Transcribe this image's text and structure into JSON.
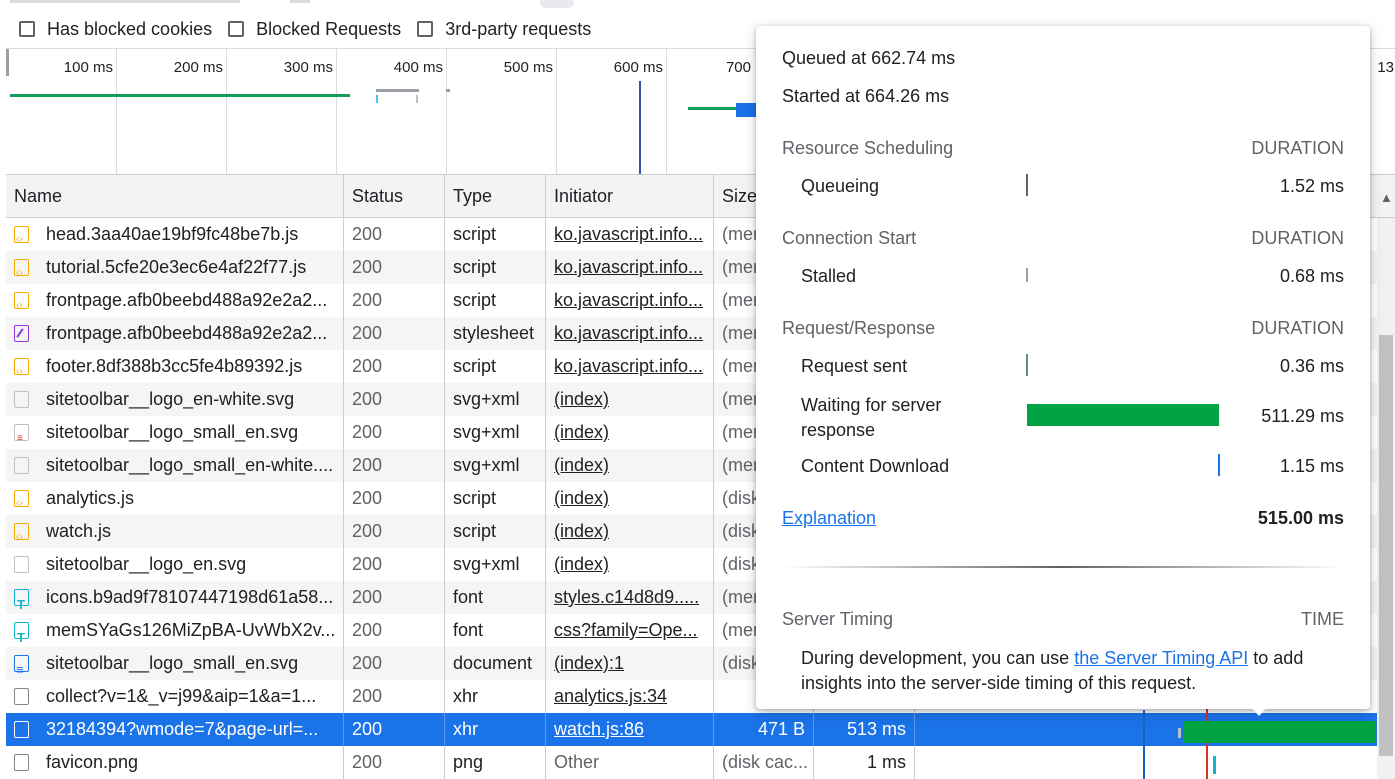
{
  "filters": [
    {
      "label": "Has blocked cookies",
      "checked": false
    },
    {
      "label": "Blocked Requests",
      "checked": false
    },
    {
      "label": "3rd-party requests",
      "checked": false
    }
  ],
  "overview": {
    "ticks": [
      "100 ms",
      "200 ms",
      "300 ms",
      "400 ms",
      "500 ms",
      "600 ms",
      "700",
      "13"
    ]
  },
  "columns": {
    "name": "Name",
    "status": "Status",
    "type": "Type",
    "initiator": "Initiator",
    "size": "Size"
  },
  "rows": [
    {
      "icon": "script",
      "name": "head.3aa40ae19bf9fc48be7b.js",
      "status": "200",
      "type": "script",
      "initiator": "ko.javascript.info...",
      "initiator_link": true,
      "size": "(mer"
    },
    {
      "icon": "script",
      "name": "tutorial.5cfe20e3ec6e4af22f77.js",
      "status": "200",
      "type": "script",
      "initiator": "ko.javascript.info...",
      "initiator_link": true,
      "size": "(mer"
    },
    {
      "icon": "script",
      "name": "frontpage.afb0beebd488a92e2a2...",
      "status": "200",
      "type": "script",
      "initiator": "ko.javascript.info...",
      "initiator_link": true,
      "size": "(mer"
    },
    {
      "icon": "css",
      "name": "frontpage.afb0beebd488a92e2a2...",
      "status": "200",
      "type": "stylesheet",
      "initiator": "ko.javascript.info...",
      "initiator_link": true,
      "size": "(mer"
    },
    {
      "icon": "script",
      "name": "footer.8df388b3cc5fe4b89392.js",
      "status": "200",
      "type": "script",
      "initiator": "ko.javascript.info...",
      "initiator_link": true,
      "size": "(mer"
    },
    {
      "icon": "svg",
      "name": "sitetoolbar__logo_en-white.svg",
      "status": "200",
      "type": "svg+xml",
      "initiator": "(index)",
      "initiator_link": true,
      "size": "(mer"
    },
    {
      "icon": "svgred",
      "name": "sitetoolbar__logo_small_en.svg",
      "status": "200",
      "type": "svg+xml",
      "initiator": "(index)",
      "initiator_link": true,
      "size": "(mer"
    },
    {
      "icon": "svg",
      "name": "sitetoolbar__logo_small_en-white....",
      "status": "200",
      "type": "svg+xml",
      "initiator": "(index)",
      "initiator_link": true,
      "size": "(mer"
    },
    {
      "icon": "script",
      "name": "analytics.js",
      "status": "200",
      "type": "script",
      "initiator": "(index)",
      "initiator_link": true,
      "size": "(disk"
    },
    {
      "icon": "script",
      "name": "watch.js",
      "status": "200",
      "type": "script",
      "initiator": "(index)",
      "initiator_link": true,
      "size": "(disk"
    },
    {
      "icon": "svg",
      "name": "sitetoolbar__logo_en.svg",
      "status": "200",
      "type": "svg+xml",
      "initiator": "(index)",
      "initiator_link": true,
      "size": "(disk"
    },
    {
      "icon": "font",
      "name": "icons.b9ad9f78107447198d61a58...",
      "status": "200",
      "type": "font",
      "initiator": "styles.c14d8d9.....",
      "initiator_link": true,
      "size": "(mer"
    },
    {
      "icon": "font",
      "name": "memSYaGs126MiZpBA-UvWbX2v...",
      "status": "200",
      "type": "font",
      "initiator": "css?family=Ope...",
      "initiator_link": true,
      "size": "(mer"
    },
    {
      "icon": "doc",
      "name": "sitetoolbar__logo_small_en.svg",
      "status": "200",
      "type": "document",
      "initiator": "(index):1",
      "initiator_link": true,
      "size": "(disk"
    },
    {
      "icon": "xhr",
      "name": "collect?v=1&_v=j99&aip=1&a=1...",
      "status": "200",
      "type": "xhr",
      "initiator": "analytics.js:34",
      "initiator_link": true,
      "size": ""
    },
    {
      "icon": "xhrsel",
      "name": "32184394?wmode=7&page-url=...",
      "status": "200",
      "type": "xhr",
      "initiator": "watch.js:86",
      "initiator_link": true,
      "size": "471 B",
      "time": "513 ms",
      "selected": true
    },
    {
      "icon": "png",
      "name": "favicon.png",
      "status": "200",
      "type": "png",
      "initiator": "Other",
      "initiator_link": false,
      "size": "(disk cac...",
      "time": "1 ms"
    }
  ],
  "timing_popup": {
    "queued_at": "Queued at 662.74 ms",
    "started_at": "Started at 664.26 ms",
    "sections": [
      {
        "title": "Resource Scheduling",
        "header": "DURATION",
        "items": [
          {
            "label": "Queueing",
            "value": "1.52 ms",
            "fraction": 0.003
          }
        ]
      },
      {
        "title": "Connection Start",
        "header": "DURATION",
        "items": [
          {
            "label": "Stalled",
            "value": "0.68 ms",
            "fraction": 0.001
          }
        ]
      },
      {
        "title": "Request/Response",
        "header": "DURATION",
        "items": [
          {
            "label": "Request sent",
            "value": "0.36 ms",
            "fraction": 0.001
          },
          {
            "label": "Waiting for server response",
            "value": "511.29 ms",
            "fraction": 0.993
          },
          {
            "label": "Content Download",
            "value": "1.15 ms",
            "fraction": 0.002
          }
        ]
      }
    ],
    "explanation_link": "Explanation",
    "total": "515.00 ms",
    "server_timing": {
      "title": "Server Timing",
      "header": "TIME",
      "text_before": "During development, you can use",
      "link": "the Server Timing API",
      "text_after": "to add insights into the server-side timing of this request."
    }
  },
  "colors": {
    "selected_row": "#1a73e8",
    "waiting_bar": "#00a443",
    "link": "#1a73e8"
  }
}
